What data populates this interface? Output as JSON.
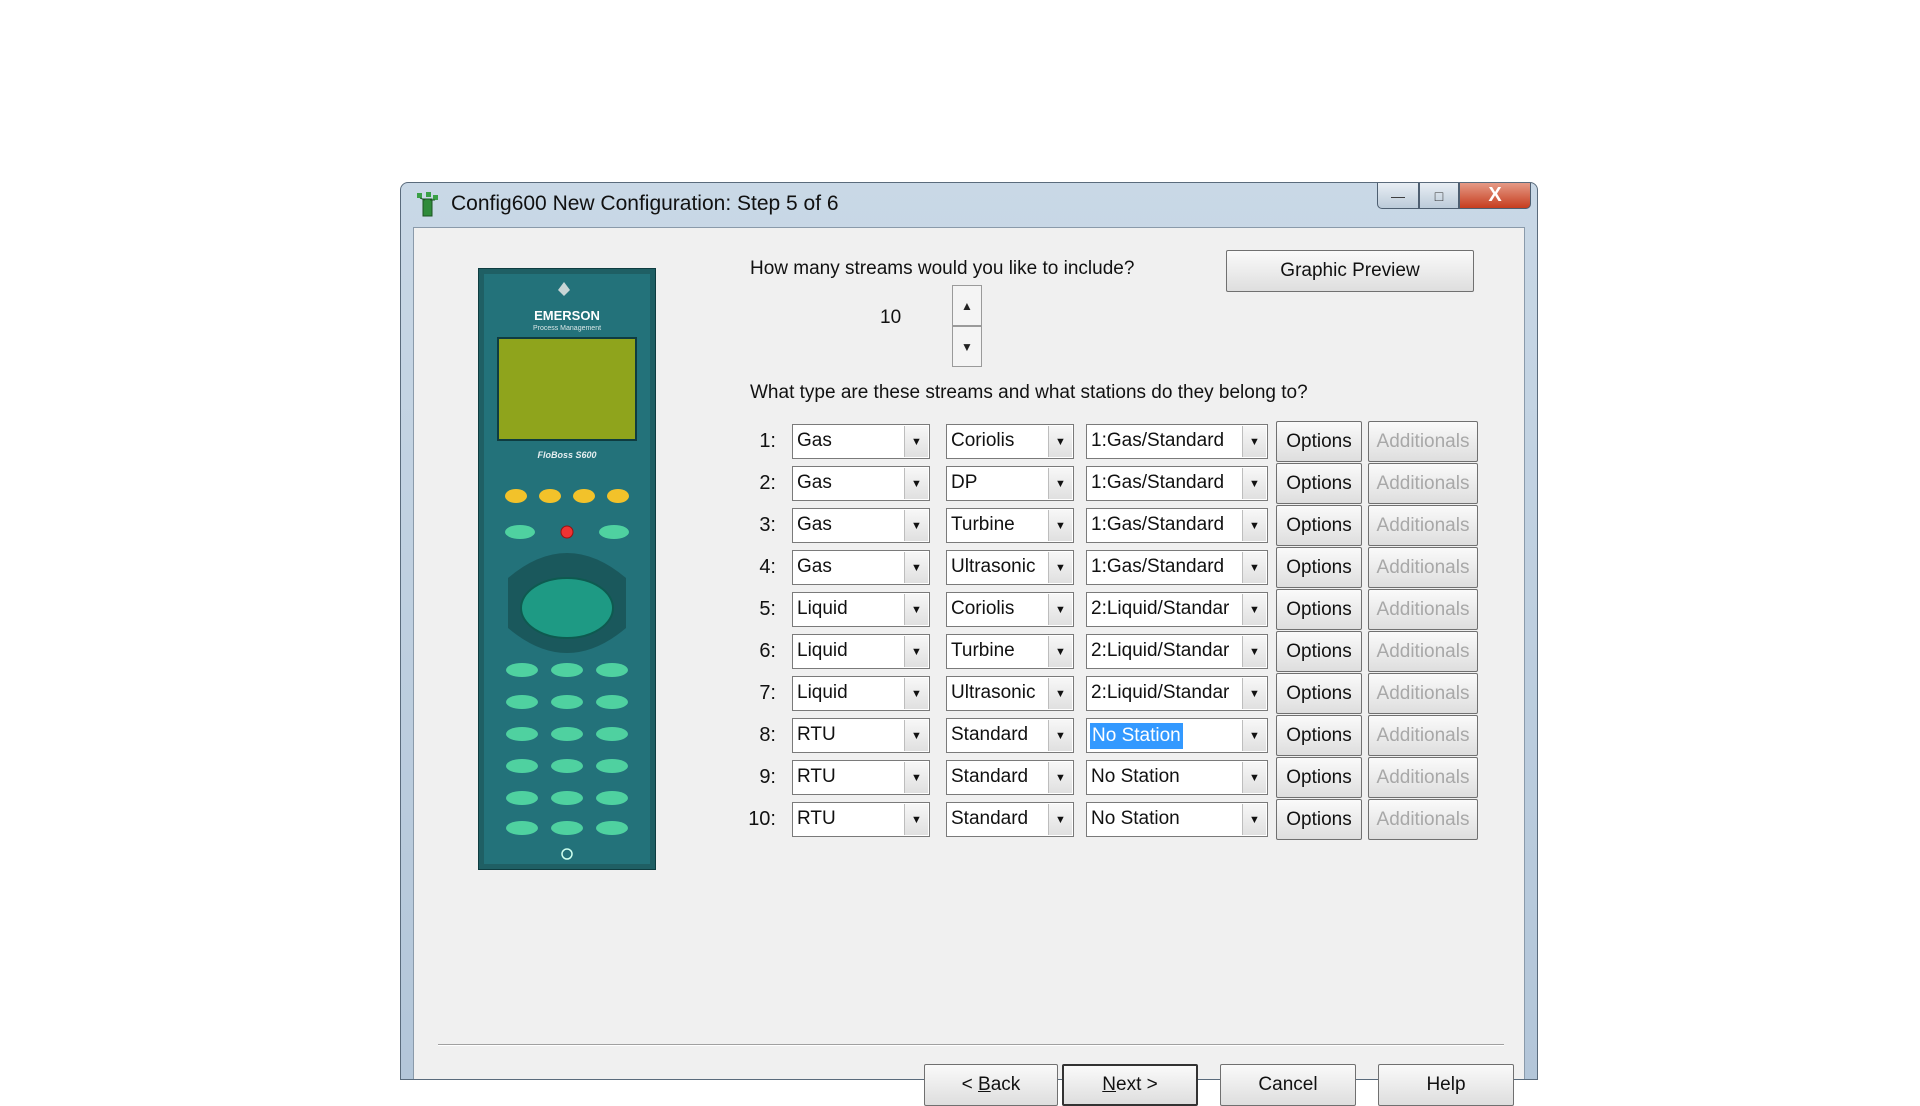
{
  "window": {
    "title": "Config600 New Configuration: Step 5 of 6",
    "controls": {
      "minimize": "—",
      "maximize": "□",
      "close": "X"
    }
  },
  "device_image": {
    "brand": "EMERSON",
    "subbrand": "Process Management",
    "model": "FloBoss S600"
  },
  "streams_question": "How many streams would you like to include?",
  "stream_count": "10",
  "graphic_preview_label": "Graphic Preview",
  "types_question": "What type are these streams and what stations do they belong to?",
  "options_label": "Options",
  "additionals_label": "Additionals",
  "rows": [
    {
      "num": "1:",
      "type": "Gas",
      "meter": "Coriolis",
      "station": "1:Gas/Standard"
    },
    {
      "num": "2:",
      "type": "Gas",
      "meter": "DP",
      "station": "1:Gas/Standard"
    },
    {
      "num": "3:",
      "type": "Gas",
      "meter": "Turbine",
      "station": "1:Gas/Standard"
    },
    {
      "num": "4:",
      "type": "Gas",
      "meter": "Ultrasonic",
      "station": "1:Gas/Standard"
    },
    {
      "num": "5:",
      "type": "Liquid",
      "meter": "Coriolis",
      "station": "2:Liquid/Standar"
    },
    {
      "num": "6:",
      "type": "Liquid",
      "meter": "Turbine",
      "station": "2:Liquid/Standar"
    },
    {
      "num": "7:",
      "type": "Liquid",
      "meter": "Ultrasonic",
      "station": "2:Liquid/Standar"
    },
    {
      "num": "8:",
      "type": "RTU",
      "meter": "Standard",
      "station": "No Station",
      "selected": true
    },
    {
      "num": "9:",
      "type": "RTU",
      "meter": "Standard",
      "station": "No Station"
    },
    {
      "num": "10:",
      "type": "RTU",
      "meter": "Standard",
      "station": "No Station"
    }
  ],
  "footer": {
    "back_label_pre": "< ",
    "back_label_mnemonic": "B",
    "back_label_post": "ack",
    "next_label_mnemonic": "N",
    "next_label_post": "ext >",
    "cancel_label": "Cancel",
    "help_label": "Help"
  },
  "colors": {
    "selection": "#3399ff",
    "device_body": "#1f6a6e",
    "device_screen": "#8fa41c",
    "close_button": "#c63d1f"
  }
}
